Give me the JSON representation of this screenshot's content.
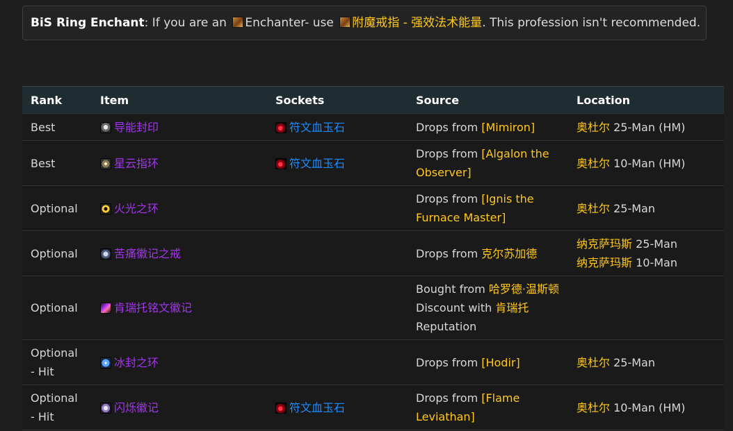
{
  "notice": {
    "label": "BiS Ring Enchant",
    "colon": ":",
    "text_before": " If you are an ",
    "profession": "Enchanter",
    "text_use": "- use ",
    "enchant_name": "附魔戒指 - 强效法术能量",
    "text_after": ". This profession isn't recommended."
  },
  "table": {
    "headers": {
      "rank": "Rank",
      "item": "Item",
      "sockets": "Sockets",
      "source": "Source",
      "location": "Location"
    },
    "rows": [
      {
        "rank": "Best",
        "item": "导能封印",
        "socket": "符文血玉石",
        "src_prefix": "Drops from ",
        "src_link": "[Mimiron]",
        "loc1_link": "奥杜尔",
        "loc1_text": " 25-Man (HM)"
      },
      {
        "rank": "Best",
        "item": "星云指环",
        "socket": "符文血玉石",
        "src_prefix": "Drops from ",
        "src_link": "[Algalon the Observer]",
        "loc1_link": "奥杜尔",
        "loc1_text": " 10-Man (HM)"
      },
      {
        "rank": "Optional",
        "item": "火光之环",
        "socket": "",
        "src_prefix": "Drops from ",
        "src_link": "[Ignis the Furnace Master]",
        "loc1_link": "奥杜尔",
        "loc1_text": " 25-Man"
      },
      {
        "rank": "Optional",
        "item": "苦痛徽记之戒",
        "socket": "",
        "src_prefix": "Drops from ",
        "src_link": "克尔苏加德",
        "loc1_link": "纳克萨玛斯",
        "loc1_text": " 25-Man",
        "loc2_link": "纳克萨玛斯",
        "loc2_text": " 10-Man"
      },
      {
        "rank": "Optional",
        "item": "肯瑞托铭文徽记",
        "socket": "",
        "src_prefix": "Bought from ",
        "src_link": "哈罗德·温斯顿",
        "src_line2_prefix": "Discount with ",
        "src_line2_link": "肯瑞托",
        "src_line3": "Reputation"
      },
      {
        "rank": "Optional - Hit",
        "item": "冰封之环",
        "socket": "",
        "src_prefix": "Drops from ",
        "src_link": "[Hodir]",
        "loc1_link": "奥杜尔",
        "loc1_text": " 25-Man"
      },
      {
        "rank": "Optional - Hit",
        "item": "闪烁徽记",
        "socket": "符文血玉石",
        "src_prefix": "Drops from ",
        "src_link": "[Flame Leviathan]",
        "loc1_link": "奥杜尔",
        "loc1_text": " 10-Man (HM)"
      }
    ]
  },
  "icons": {
    "profession": "enchanting-profession-icon",
    "enchant": "enchant-scroll-icon",
    "socket": "runed-bloodstone-gem-icon"
  },
  "colors": {
    "link_gold": "#ffc81a",
    "epic_purple": "#a335ee",
    "gem_blue": "#1e8cff"
  }
}
